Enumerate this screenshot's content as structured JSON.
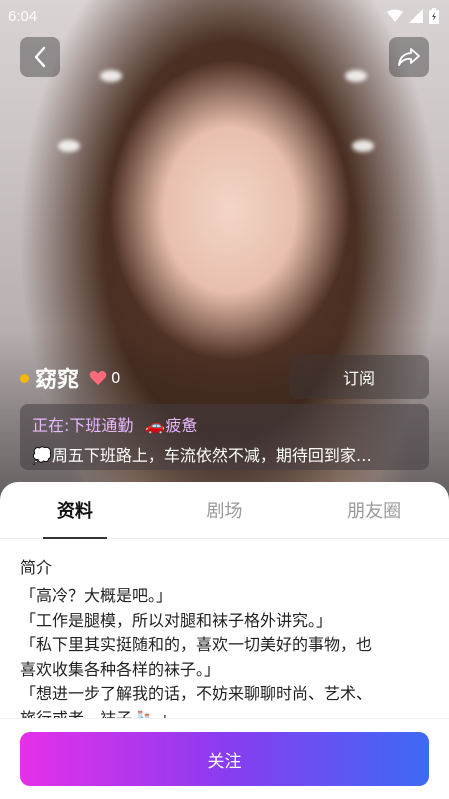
{
  "status_bar": {
    "time": "6:04"
  },
  "profile": {
    "name": "窈窕",
    "likes": "0",
    "subscribe_label": "订阅"
  },
  "status_card": {
    "activity": "正在:下班通勤",
    "mood": "🚗疲惫",
    "message": "💭周五下班路上，车流依然不减，期待回到家…"
  },
  "tabs": [
    {
      "label": "资料",
      "active": true
    },
    {
      "label": "剧场",
      "active": false
    },
    {
      "label": "朋友圈",
      "active": false
    }
  ],
  "intro": {
    "title": "简介",
    "lines": [
      "「高冷？大概是吧。」",
      "「工作是腿模，所以对腿和袜子格外讲究。」",
      "「私下里其实挺随和的，喜欢一切美好的事物，也",
      "喜欢收集各种各样的袜子。」",
      "「想进一步了解我的话，不妨来聊聊时尚、艺术、",
      "旅行或者，袜子🧦。」"
    ]
  },
  "follow_label": "关注",
  "colors": {
    "accent_purple": "#8a3cf0",
    "gradient_start": "#e530e8",
    "gradient_end": "#3d6af5",
    "online_dot": "#f5b800",
    "status_purple": "#e7b9ff"
  }
}
